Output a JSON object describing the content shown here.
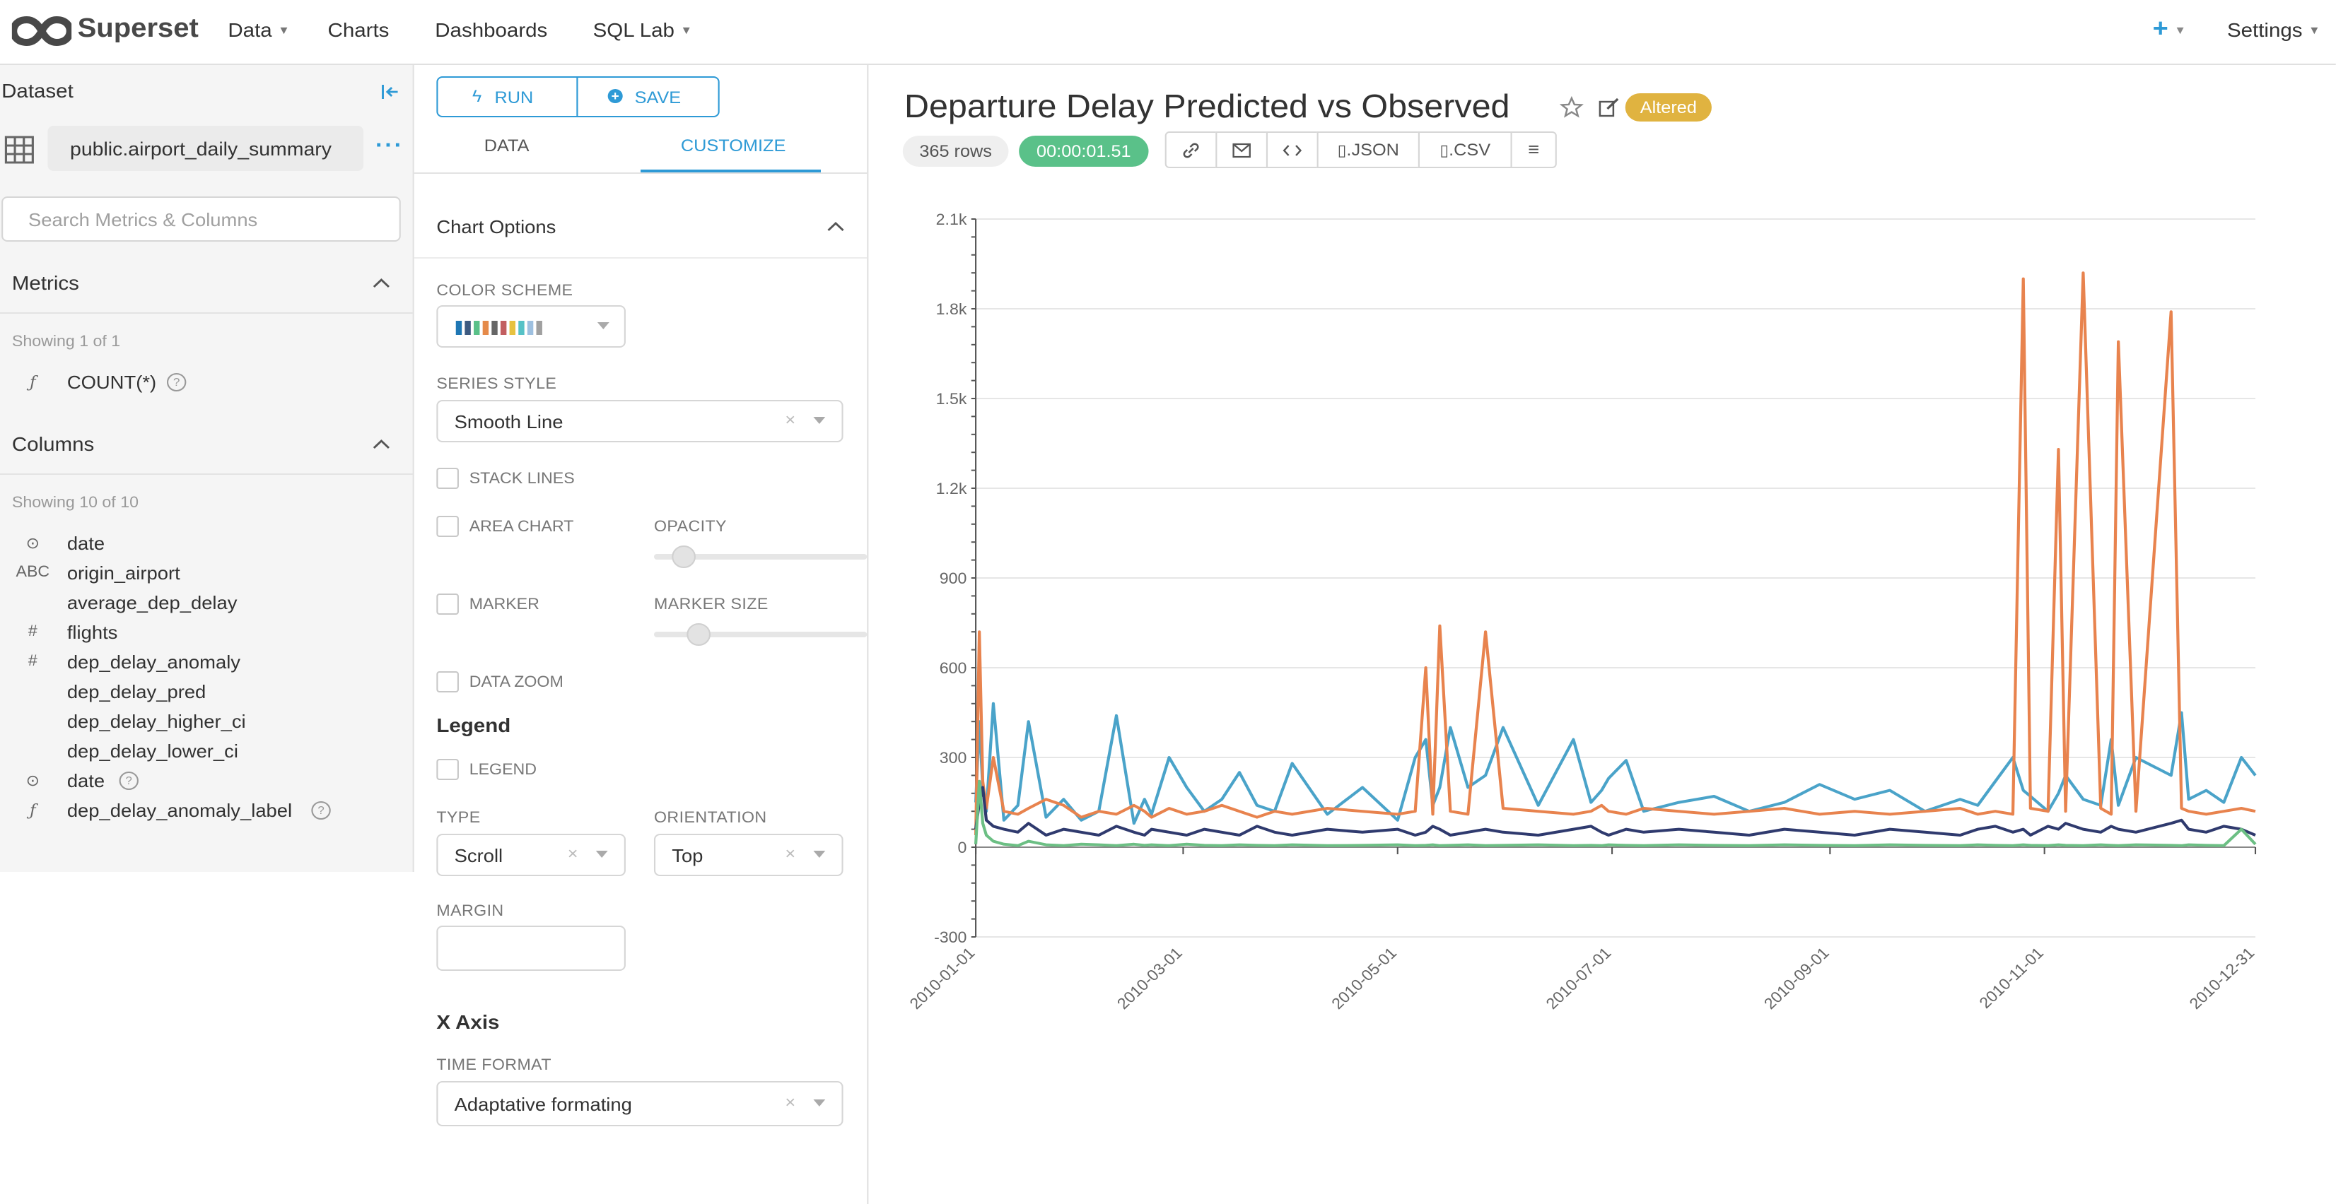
{
  "nav": {
    "brand": "Superset",
    "data": "Data",
    "charts": "Charts",
    "dashboards": "Dashboards",
    "sqllab": "SQL Lab",
    "settings": "Settings",
    "plus": "+"
  },
  "dataset_panel": {
    "header": "Dataset",
    "dataset_name": "public.airport_daily_summary",
    "search_placeholder": "Search Metrics & Columns",
    "metrics_title": "Metrics",
    "metrics_showing": "Showing 1 of 1",
    "metrics": [
      {
        "type": "ƒ",
        "name": "COUNT(*)"
      }
    ],
    "columns_title": "Columns",
    "columns_showing": "Showing 10 of 10",
    "columns": [
      {
        "type": "⊙",
        "name": "date"
      },
      {
        "type": "ABC",
        "name": "origin_airport"
      },
      {
        "type": "",
        "name": "average_dep_delay"
      },
      {
        "type": "#",
        "name": "flights"
      },
      {
        "type": "#",
        "name": "dep_delay_anomaly"
      },
      {
        "type": "",
        "name": "dep_delay_pred"
      },
      {
        "type": "",
        "name": "dep_delay_higher_ci"
      },
      {
        "type": "",
        "name": "dep_delay_lower_ci"
      },
      {
        "type": "⊙",
        "name": "date"
      },
      {
        "type": "ƒ",
        "name": "dep_delay_anomaly_label"
      }
    ]
  },
  "control_panel": {
    "run": "RUN",
    "save": "SAVE",
    "tab_data": "DATA",
    "tab_customize": "CUSTOMIZE",
    "chart_options": "Chart Options",
    "color_scheme_label": "COLOR SCHEME",
    "color_scheme_colors": [
      "#1f77b4",
      "#3d5a80",
      "#5ac189",
      "#e58a4a",
      "#666666",
      "#c25e60",
      "#e7c240",
      "#56c2c7",
      "#9ec0e0",
      "#a0a0a0"
    ],
    "series_style_label": "SERIES STYLE",
    "series_style_value": "Smooth Line",
    "stack_lines": "STACK LINES",
    "area_chart": "AREA CHART",
    "opacity": "OPACITY",
    "marker": "MARKER",
    "marker_size": "MARKER SIZE",
    "data_zoom": "DATA ZOOM",
    "legend_title": "Legend",
    "legend": "LEGEND",
    "type_label": "TYPE",
    "type_value": "Scroll",
    "orientation_label": "ORIENTATION",
    "orientation_value": "Top",
    "margin_label": "MARGIN",
    "xaxis_title": "X Axis",
    "time_format_label": "TIME FORMAT",
    "time_format_value": "Adaptative formating"
  },
  "chart_header": {
    "title": "Departure Delay Predicted vs Observed",
    "altered": "Altered",
    "rows": "365 rows",
    "timer": "00:00:01.51",
    "json": ".JSON",
    "csv": ".CSV"
  },
  "chart_data": {
    "type": "line",
    "yticks": [
      "2.1k",
      "1.8k",
      "1.5k",
      "1.2k",
      "900",
      "600",
      "300",
      "0",
      "-300"
    ],
    "ylim": [
      -300,
      2100
    ],
    "xticks": [
      "2010-01-01",
      "2010-03-01",
      "2010-05-01",
      "2010-07-01",
      "2010-09-01",
      "2010-11-01",
      "2010-12-31"
    ],
    "x": [
      0,
      1,
      2,
      3,
      5,
      8,
      12,
      15,
      20,
      25,
      30,
      35,
      40,
      45,
      48,
      50,
      55,
      60,
      65,
      70,
      75,
      80,
      85,
      90,
      100,
      110,
      120,
      125,
      128,
      130,
      132,
      135,
      140,
      145,
      150,
      160,
      170,
      175,
      178,
      180,
      185,
      190,
      200,
      210,
      220,
      230,
      240,
      250,
      260,
      270,
      280,
      285,
      290,
      295,
      298,
      300,
      305,
      308,
      310,
      315,
      320,
      323,
      325,
      330,
      340,
      343,
      345,
      350,
      355,
      360,
      364
    ],
    "series": [
      {
        "color": "#4aa3c9",
        "values": [
          150,
          420,
          200,
          120,
          480,
          90,
          140,
          420,
          100,
          160,
          90,
          120,
          440,
          80,
          160,
          110,
          300,
          200,
          120,
          160,
          250,
          140,
          120,
          280,
          110,
          200,
          90,
          300,
          360,
          140,
          200,
          400,
          200,
          240,
          400,
          140,
          360,
          150,
          190,
          230,
          290,
          120,
          150,
          170,
          120,
          150,
          210,
          160,
          190,
          120,
          160,
          140,
          220,
          300,
          190,
          170,
          120,
          180,
          240,
          160,
          140,
          360,
          140,
          300,
          240,
          450,
          160,
          190,
          150,
          300,
          240
        ]
      },
      {
        "color": "#e8834e",
        "values": [
          40,
          720,
          220,
          130,
          300,
          120,
          110,
          130,
          160,
          140,
          100,
          120,
          110,
          140,
          120,
          100,
          130,
          110,
          120,
          140,
          120,
          100,
          120,
          110,
          130,
          120,
          110,
          120,
          600,
          110,
          740,
          120,
          110,
          720,
          130,
          120,
          110,
          120,
          140,
          120,
          110,
          130,
          120,
          110,
          120,
          130,
          110,
          120,
          110,
          120,
          130,
          110,
          120,
          110,
          1900,
          130,
          120,
          1330,
          120,
          1920,
          130,
          110,
          1690,
          120,
          1790,
          130,
          120,
          110,
          120,
          130,
          120
        ]
      },
      {
        "color": "#2f3a6e",
        "values": [
          60,
          150,
          200,
          90,
          70,
          60,
          50,
          80,
          40,
          60,
          50,
          40,
          70,
          50,
          40,
          60,
          50,
          40,
          60,
          50,
          40,
          70,
          50,
          40,
          60,
          50,
          60,
          40,
          50,
          70,
          60,
          40,
          50,
          60,
          50,
          40,
          60,
          70,
          50,
          40,
          60,
          50,
          60,
          50,
          40,
          60,
          50,
          40,
          60,
          50,
          40,
          60,
          70,
          50,
          60,
          40,
          70,
          60,
          80,
          60,
          50,
          70,
          60,
          50,
          80,
          90,
          60,
          50,
          70,
          60,
          40
        ]
      },
      {
        "color": "#6cbf84",
        "values": [
          10,
          220,
          80,
          40,
          20,
          10,
          5,
          20,
          8,
          5,
          10,
          8,
          5,
          10,
          6,
          8,
          5,
          10,
          6,
          5,
          8,
          6,
          5,
          8,
          5,
          6,
          8,
          5,
          6,
          8,
          5,
          6,
          8,
          5,
          6,
          8,
          5,
          6,
          5,
          8,
          6,
          5,
          8,
          6,
          5,
          8,
          6,
          5,
          8,
          6,
          5,
          8,
          6,
          5,
          8,
          6,
          5,
          8,
          6,
          5,
          8,
          6,
          5,
          8,
          6,
          5,
          8,
          6,
          5,
          60,
          10
        ]
      }
    ]
  }
}
